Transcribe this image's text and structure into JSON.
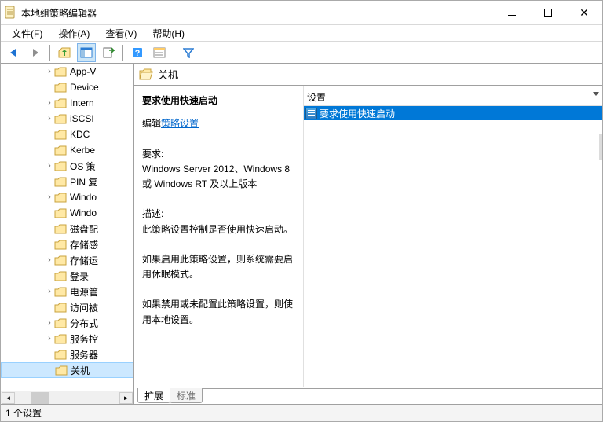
{
  "title": "本地组策略编辑器",
  "menu": {
    "file": "文件(F)",
    "action": "操作(A)",
    "view": "查看(V)",
    "help": "帮助(H)"
  },
  "tree": [
    {
      "label": "App-V",
      "caret": true
    },
    {
      "label": "Device",
      "caret": false
    },
    {
      "label": "Intern",
      "caret": true
    },
    {
      "label": "iSCSI",
      "caret": true
    },
    {
      "label": "KDC",
      "caret": false
    },
    {
      "label": "Kerbe",
      "caret": false
    },
    {
      "label": "OS 策",
      "caret": true
    },
    {
      "label": "PIN 复",
      "caret": false
    },
    {
      "label": "Windo",
      "caret": true
    },
    {
      "label": "Windo",
      "caret": false
    },
    {
      "label": "磁盘配",
      "caret": false
    },
    {
      "label": "存储感",
      "caret": false
    },
    {
      "label": "存储运",
      "caret": true
    },
    {
      "label": "登录",
      "caret": false
    },
    {
      "label": "电源管",
      "caret": true
    },
    {
      "label": "访问被",
      "caret": false
    },
    {
      "label": "分布式",
      "caret": true
    },
    {
      "label": "服务控",
      "caret": true
    },
    {
      "label": "服务器",
      "caret": false
    },
    {
      "label": "关机",
      "caret": false,
      "selected": true
    }
  ],
  "path": {
    "label": "关机"
  },
  "desc": {
    "title": "要求使用快速启动",
    "edit_prefix": "编辑",
    "edit_link": "策略设置",
    "req_label": "要求:",
    "req_text": "Windows Server 2012、Windows 8 或 Windows RT 及以上版本",
    "desc_label": "描述:",
    "p1": "此策略设置控制是否使用快速启动。",
    "p2": "如果启用此策略设置，则系统需要启用休眠模式。",
    "p3": "如果禁用或未配置此策略设置，则使用本地设置。"
  },
  "settings": {
    "header": "设置",
    "items": [
      {
        "label": "要求使用快速启动"
      }
    ]
  },
  "tabs": {
    "extended": "扩展",
    "standard": "标准"
  },
  "status": "1 个设置"
}
